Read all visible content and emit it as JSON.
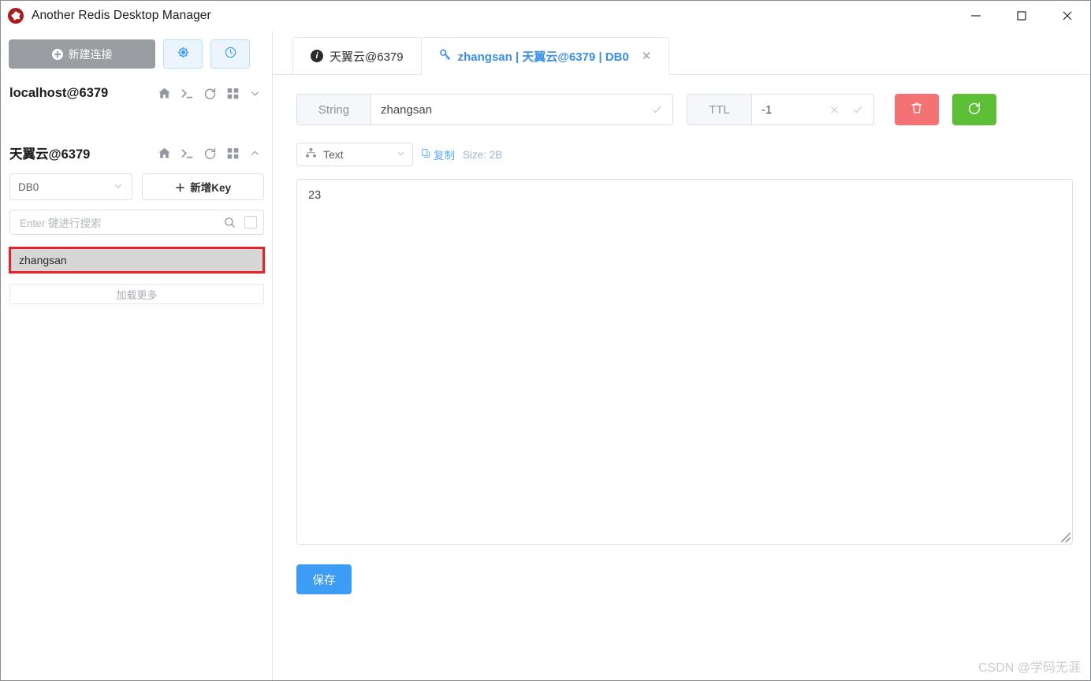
{
  "window": {
    "title": "Another Redis Desktop Manager",
    "logo_icon": "redis-logo-icon",
    "minimize_icon": "minimize-icon",
    "maximize_icon": "maximize-icon",
    "close_icon": "close-icon"
  },
  "sidebar": {
    "new_connection_label": "新建连接",
    "settings_icon": "gear-icon",
    "history_icon": "clock-icon",
    "connections": [
      {
        "name": "localhost@6379",
        "expanded": false,
        "icons": [
          "home-icon",
          "console-icon",
          "refresh-icon",
          "grid-icon",
          "chevron-down-icon"
        ]
      },
      {
        "name": "天翼云@6379",
        "expanded": true,
        "icons": [
          "home-icon",
          "console-icon",
          "refresh-icon",
          "grid-icon",
          "chevron-up-icon"
        ]
      }
    ],
    "db_selected": "DB0",
    "add_key_label": "新增Key",
    "search_placeholder": "Enter 键进行搜索",
    "search_value": "",
    "search_icon": "magnifier-icon",
    "search_checkbox_checked": false,
    "keys": [
      {
        "label": "zhangsan",
        "selected": true
      }
    ],
    "load_more_label": "加载更多"
  },
  "main": {
    "tabs": [
      {
        "label": "天翼云@6379",
        "icon": "info-icon",
        "active": false,
        "closable": false
      },
      {
        "label": "zhangsan | 天翼云@6379 | DB0",
        "icon": "key-icon",
        "active": true,
        "closable": true,
        "close_label": "✕"
      }
    ],
    "key_type_label": "String",
    "key_name": "zhangsan",
    "key_confirm_icon": "check-icon",
    "ttl_label": "TTL",
    "ttl_value": "-1",
    "ttl_clear_icon": "close-icon",
    "ttl_confirm_icon": "check-icon",
    "delete_icon": "trash-icon",
    "refresh_icon": "refresh-icon",
    "format_selected": "Text",
    "format_icon": "sitemap-icon",
    "copy_label": "复制",
    "copy_icon": "copy-icon",
    "size_label": "Size: 2B",
    "value_text": "23",
    "save_label": "保存"
  },
  "watermark": "CSDN @学码无涯",
  "colors": {
    "accent": "#3d9cf4",
    "danger": "#f47174",
    "success": "#5cbf36",
    "highlight_border": "#ec2024",
    "new_conn_bg": "#9a9ea3"
  }
}
